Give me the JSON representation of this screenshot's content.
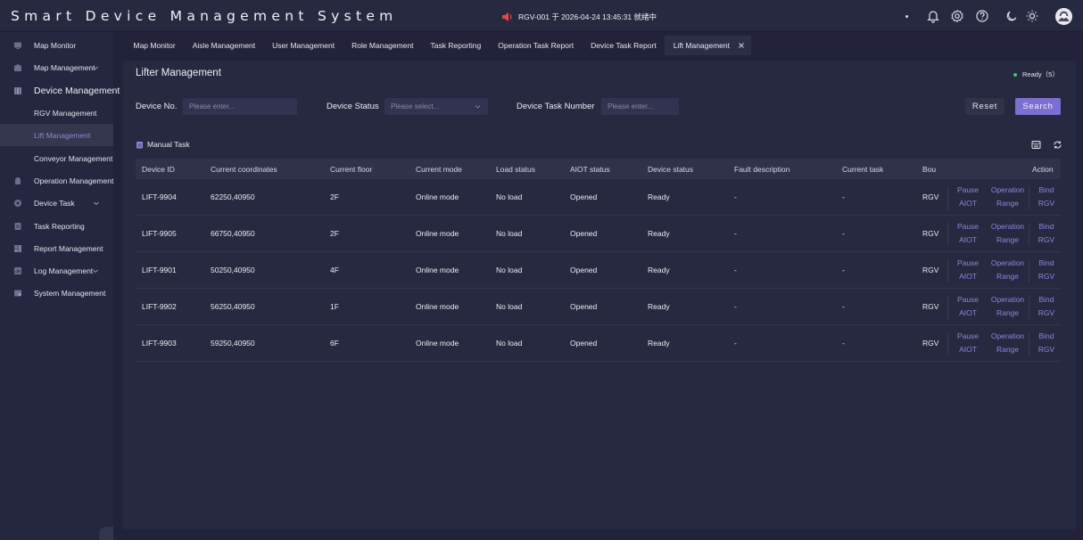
{
  "header": {
    "title": "Smart Device Management System",
    "alert_text": "RGV-001 于 2026-04-24 13:45:31 就绪中",
    "icons": [
      "bell-icon",
      "gear-icon",
      "help-icon",
      "moon-icon",
      "sun-icon",
      "avatar"
    ]
  },
  "sidebar": {
    "items": [
      {
        "label": "Map Monitor",
        "icon": "monitor-icon"
      },
      {
        "label": "Map Management",
        "icon": "map-icon"
      },
      {
        "label": "Device Management",
        "icon": "device-icon"
      },
      {
        "label": "RGV Management"
      },
      {
        "label": "Lift Management"
      },
      {
        "label": "Conveyor Management"
      },
      {
        "label": "Operation Management",
        "icon": "operation-icon"
      },
      {
        "label": "Device Task",
        "icon": "task-icon"
      },
      {
        "label": "Task Reporting",
        "icon": "report-icon"
      },
      {
        "label": "Report Management",
        "icon": "chart-icon"
      },
      {
        "label": "Log Management",
        "icon": "log-icon"
      },
      {
        "label": "System Management",
        "icon": "system-icon"
      }
    ]
  },
  "tabs": [
    "Map Monitor",
    "Aisle Management",
    "User Management",
    "Role Management",
    "Task Reporting",
    "Operation Task Report",
    "Device Task Report",
    "Lift Management"
  ],
  "page": {
    "title": "Lifter Management",
    "ready_status": "Ready（5）"
  },
  "filters": {
    "device_no_label": "Device No.",
    "device_no_placeholder": "Please enter...",
    "device_status_label": "Device Status",
    "device_status_placeholder": "Please select...",
    "task_number_label": "Device Task Number",
    "task_number_placeholder": "Please enter...",
    "reset": "Reset",
    "search": "Search"
  },
  "manual_task": "Manual Task",
  "table": {
    "columns": [
      "Device ID",
      "Current coordinates",
      "Current floor",
      "Current mode",
      "Load status",
      "AIOT status",
      "Device status",
      "Fault description",
      "Current task",
      "Bou",
      "Action"
    ],
    "rows": [
      {
        "id": "LIFT-9904",
        "coords": "62250,40950",
        "floor": "2F",
        "mode": "Online mode",
        "load": "No load",
        "aiot": "Opened",
        "status": "Ready",
        "fault": "-",
        "task": "-",
        "bound": "RGV"
      },
      {
        "id": "LIFT-9905",
        "coords": "66750,40950",
        "floor": "2F",
        "mode": "Online mode",
        "load": "No load",
        "aiot": "Opened",
        "status": "Ready",
        "fault": "-",
        "task": "-",
        "bound": "RGV"
      },
      {
        "id": "LIFT-9901",
        "coords": "50250,40950",
        "floor": "4F",
        "mode": "Online mode",
        "load": "No load",
        "aiot": "Opened",
        "status": "Ready",
        "fault": "-",
        "task": "-",
        "bound": "RGV"
      },
      {
        "id": "LIFT-9902",
        "coords": "56250,40950",
        "floor": "1F",
        "mode": "Online mode",
        "load": "No load",
        "aiot": "Opened",
        "status": "Ready",
        "fault": "-",
        "task": "-",
        "bound": "RGV"
      },
      {
        "id": "LIFT-9903",
        "coords": "59250,40950",
        "floor": "6F",
        "mode": "Online mode",
        "load": "No load",
        "aiot": "Opened",
        "status": "Ready",
        "fault": "-",
        "task": "-",
        "bound": "RGV"
      }
    ],
    "actions": [
      {
        "line1": "Pause",
        "line2": "AIOT"
      },
      {
        "line1": "Operation",
        "line2": "Range"
      },
      {
        "line1": "Bind",
        "line2": "RGV"
      }
    ]
  },
  "colors": {
    "accent": "#7b6fd1",
    "link": "#8e86d8",
    "ready_dot": "#3fc66b",
    "background": "#22233a"
  }
}
